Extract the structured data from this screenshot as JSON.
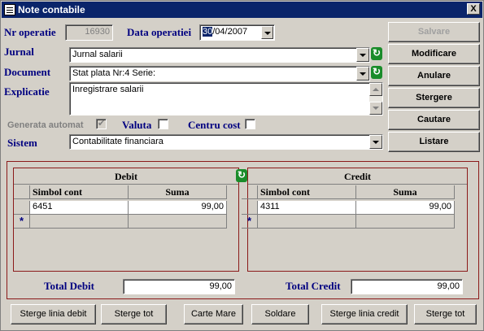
{
  "window": {
    "title": "Note contabile",
    "close_label": "X"
  },
  "header": {
    "nr_operatie_label": "Nr operatie",
    "nr_operatie_value": "16930",
    "data_operatiei_label": "Data operatiei",
    "data_day": "30",
    "data_rest": "/04/2007"
  },
  "form": {
    "jurnal_label": "Jurnal",
    "jurnal_value": "Jurnal salarii",
    "document_label": "Document",
    "document_value": "Stat plata Nr:4 Serie:",
    "explicatie_label": "Explicatie",
    "explicatie_value": "Inregistrare salarii",
    "generata_label": "Generata automat",
    "valuta_label": "Valuta",
    "centru_cost_label": "Centru cost",
    "sistem_label": "Sistem",
    "sistem_value": "Contabilitate financiara"
  },
  "side_buttons": {
    "salvare": "Salvare",
    "modificare": "Modificare",
    "anulare": "Anulare",
    "stergere": "Stergere",
    "cautare": "Cautare",
    "listare": "Listare"
  },
  "debit": {
    "title": "Debit",
    "col_cont": "Simbol cont",
    "col_suma": "Suma",
    "rows": [
      {
        "cont": "6451",
        "suma": "99,00"
      }
    ],
    "new_row_marker": "*"
  },
  "credit": {
    "title": "Credit",
    "col_cont": "Simbol cont",
    "col_suma": "Suma",
    "rows": [
      {
        "cont": "4311",
        "suma": "99,00"
      }
    ],
    "new_row_marker": "*"
  },
  "totals": {
    "total_debit_label": "Total Debit",
    "total_debit_value": "99,00",
    "total_credit_label": "Total Credit",
    "total_credit_value": "99,00"
  },
  "bottom_buttons": {
    "sterge_linia_debit": "Sterge linia debit",
    "sterge_tot_debit": "Sterge tot",
    "carte_mare": "Carte Mare",
    "soldare": "Soldare",
    "sterge_linia_credit": "Sterge linia credit",
    "sterge_tot_credit": "Sterge tot"
  },
  "icons": {
    "refresh": "refresh-icon",
    "dropdown": "chevron-down-icon",
    "app": "notes-icon"
  },
  "colors": {
    "title_bar": "#0a246a",
    "label_text": "#000080",
    "panel_border": "#8b1a1a",
    "refresh_icon": "#1a8c2a"
  }
}
